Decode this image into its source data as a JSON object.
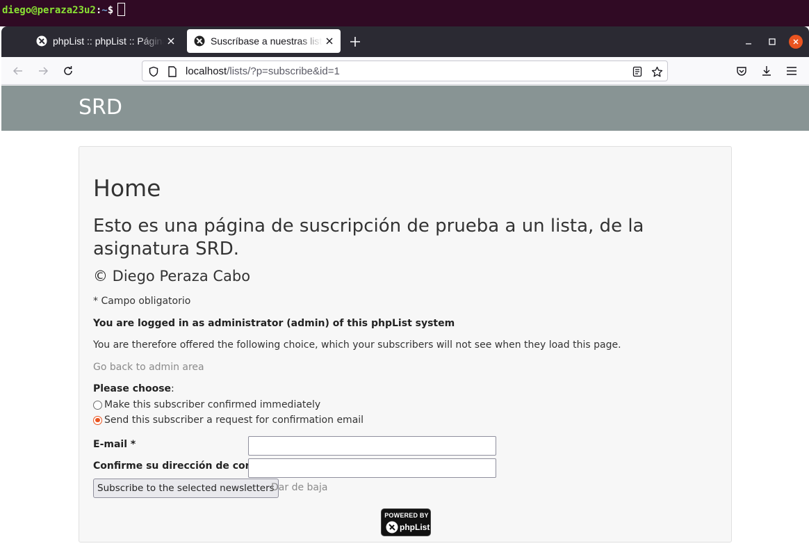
{
  "terminal": {
    "user_host": "diego@peraza23u2",
    "path": "~",
    "prompt_suffix": "$"
  },
  "browser": {
    "tabs": [
      {
        "title": "phpList :: phpList :: Página",
        "active": false
      },
      {
        "title": "Suscríbase a nuestras listas",
        "active": true
      }
    ],
    "url_host": "localhost",
    "url_path": "/lists/?p=subscribe&id=1",
    "accent_color": "#e95420"
  },
  "site": {
    "header_title": "SRD",
    "header_color": "#889494"
  },
  "content": {
    "heading": "Home",
    "intro": "Esto es una página de suscripción de prueba a un lista, de la asignatura SRD.",
    "copyright": "© Diego Peraza Cabo",
    "required_note": "* Campo obligatorio",
    "admin_notice": "You are logged in as administrator (admin) of this phpList system",
    "offer_text": "You are therefore offered the following choice, which your subscribers will not see when they load this page.",
    "admin_link": "Go back to admin area",
    "choose_label": "Please choose",
    "choose_colon": ":",
    "options": [
      {
        "label": "Make this subscriber confirmed immediately",
        "checked": false
      },
      {
        "label": "Send this subscriber a request for confirmation email",
        "checked": true
      }
    ]
  },
  "form": {
    "email_label": "E-mail *",
    "email_value": "",
    "confirm_label": "Confirme su dirección de correo *",
    "confirm_value": "",
    "subscribe_button": "Subscribe to the selected newsletters",
    "unsubscribe_link": "Dar de baja"
  },
  "footer": {
    "powered_by": "POWERED BY",
    "brand": "phpList"
  }
}
